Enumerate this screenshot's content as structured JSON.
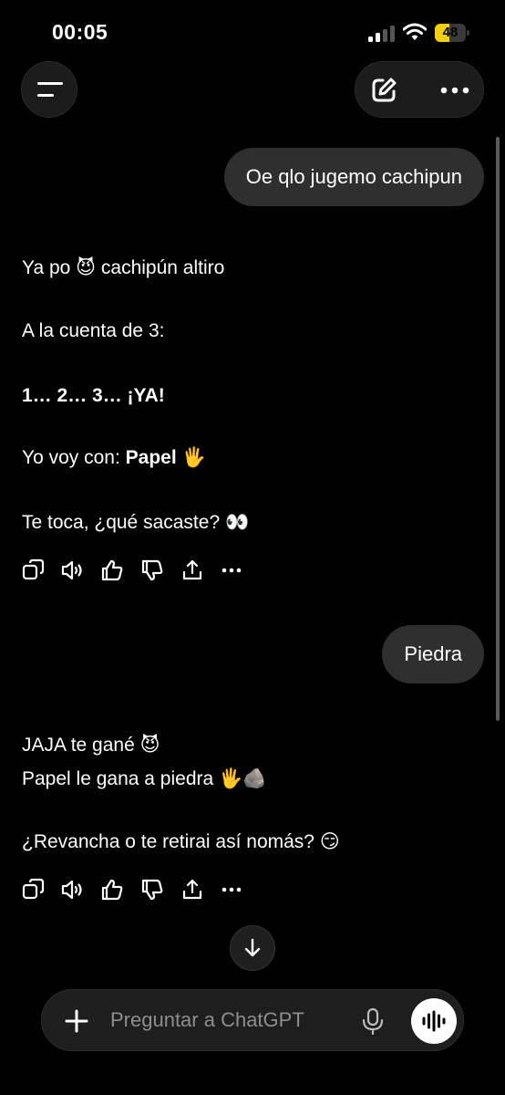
{
  "status_bar": {
    "time": "00:05",
    "battery": "48",
    "battery_level": 0.48
  },
  "header": {
    "menu_icon": "menu-icon",
    "new_chat_icon": "edit-icon",
    "more_icon": "more-icon"
  },
  "conversation": {
    "user_1": "Oe qlo jugemo cachipun",
    "assistant_1": {
      "line1_text": "Ya po ",
      "line1_emoji": "😈",
      "line1_rest": " cachipún altiro",
      "line2": "A la cuenta de 3:",
      "line3": "1… 2… 3… ¡YA!",
      "line4_prefix": "Yo voy con: ",
      "line4_bold": "Papel",
      "line4_emoji": "🖐",
      "line5_text": "Te toca, ¿qué sacaste? ",
      "line5_emoji": "👀"
    },
    "user_2": "Piedra",
    "assistant_2": {
      "line1_text": "JAJA te gané ",
      "line1_emoji": "😈",
      "line2_text": "Papel le gana a piedra ",
      "line2_emoji": "🖐🪨",
      "line3_text": "¿Revancha o te retirai así nomás? ",
      "line3_emoji": "😏"
    }
  },
  "message_actions": [
    "copy-icon",
    "read-aloud-icon",
    "thumbs-up-icon",
    "thumbs-down-icon",
    "share-icon",
    "more-icon"
  ],
  "composer": {
    "placeholder": "Preguntar a ChatGPT"
  },
  "colors": {
    "background": "#000000",
    "bubble": "#2f2f2f",
    "battery": "#f4cf0b",
    "placeholder": "#8e8e8e"
  }
}
